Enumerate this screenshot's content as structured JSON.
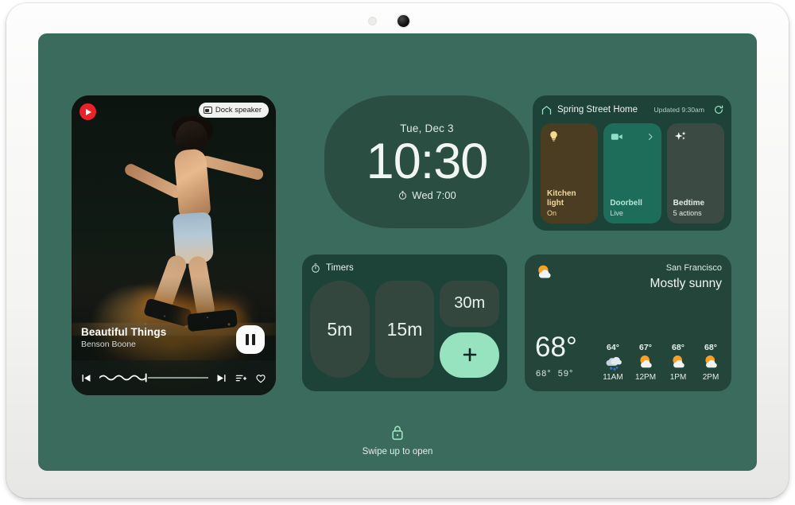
{
  "device": {
    "camera": "front-camera",
    "sensor": "ambient-light-sensor"
  },
  "media": {
    "app_icon": "youtube-music-icon",
    "output_chip": {
      "icon": "speaker-icon",
      "label": "Dock speaker"
    },
    "title": "Beautiful Things",
    "artist": "Benson Boone",
    "play_state_icon": "pause-icon",
    "controls": [
      {
        "name": "previous-track-icon",
        "glyph": "skip-previous"
      },
      {
        "name": "progress-slider",
        "glyph": "wavy-progress"
      },
      {
        "name": "next-track-icon",
        "glyph": "skip-next"
      },
      {
        "name": "add-to-queue-icon",
        "glyph": "playlist-add"
      },
      {
        "name": "favorite-icon",
        "glyph": "heart-outline"
      }
    ],
    "progress_percent": 42
  },
  "clock": {
    "date": "Tue, Dec 3",
    "time": "10:30",
    "alarm_icon": "alarm-icon",
    "alarm": "Wed 7:00"
  },
  "home": {
    "icon": "home-icon",
    "name": "Spring Street Home",
    "updated": "Updated 9:30am",
    "refresh_icon": "refresh-icon",
    "tiles": [
      {
        "id": "kitchen-light",
        "icon": "lightbulb-icon",
        "label": "Kitchen light",
        "state": "On",
        "color": "#4a3d22"
      },
      {
        "id": "doorbell",
        "icon": "videocam-icon",
        "label": "Doorbell",
        "state": "Live",
        "chevron": "chevron-right-icon",
        "color": "#1e6d5b"
      },
      {
        "id": "bedtime",
        "icon": "sparkles-icon",
        "label": "Bedtime",
        "state": "5 actions",
        "color": "#3b4b43"
      }
    ]
  },
  "timers": {
    "icon": "timer-icon",
    "title": "Timers",
    "presets": [
      "5m",
      "15m",
      "30m"
    ],
    "add_label": "+"
  },
  "weather": {
    "condition_icon": "sun-behind-cloud-icon",
    "location": "San Francisco",
    "condition": "Mostly sunny",
    "current_temp": "68°",
    "high": "68°",
    "low": "59°",
    "hourly": [
      {
        "temp": "64°",
        "icon": "rain-cloud-icon",
        "time": "11AM"
      },
      {
        "temp": "67°",
        "icon": "sun-behind-cloud-icon",
        "time": "12PM"
      },
      {
        "temp": "68°",
        "icon": "sun-behind-cloud-icon",
        "time": "1PM"
      },
      {
        "temp": "68°",
        "icon": "sun-behind-cloud-icon",
        "time": "2PM"
      }
    ]
  },
  "lock": {
    "icon": "lock-closed-icon",
    "hint": "Swipe up to open"
  },
  "colors": {
    "wallpaper": "#3b6b5c",
    "panel": "#1d4237",
    "clock_panel": "#2a4e41",
    "mint_accent": "#97e3c0",
    "tile_light": "#4a3d22",
    "tile_doorbell": "#1e6d5b",
    "tile_bedtime": "#3b4b43"
  }
}
